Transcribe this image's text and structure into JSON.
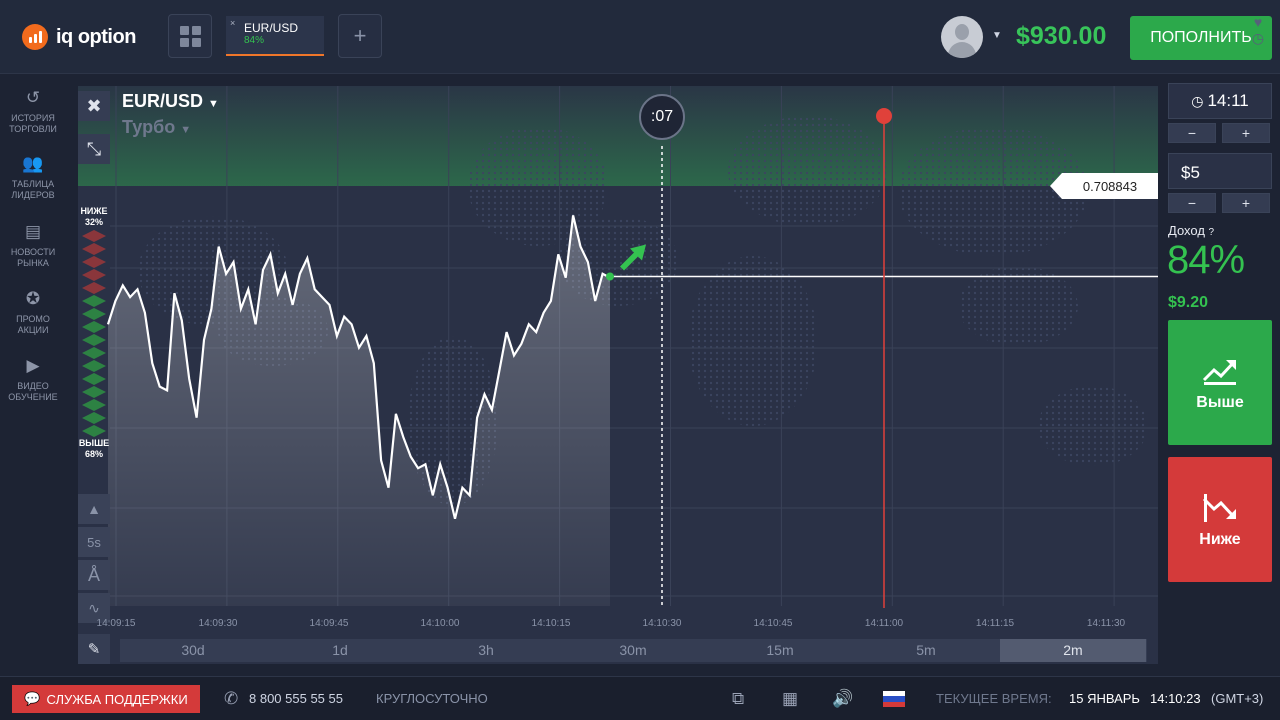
{
  "header": {
    "logo_text": "iq option",
    "asset_tab": {
      "close": "×",
      "name": "EUR/USD",
      "payout": "84%"
    },
    "add_tab": "+",
    "balance": "$930.00",
    "deposit_label": "ПОПОЛНИТЬ"
  },
  "sidebar": {
    "items": [
      {
        "label": "ИСТОРИЯ ТОРГОВЛИ",
        "icon": "history-icon"
      },
      {
        "label": "ТАБЛИЦА ЛИДЕРОВ",
        "icon": "leaders-icon"
      },
      {
        "label": "НОВОСТИ РЫНКА",
        "icon": "news-icon"
      },
      {
        "label": "ПРОМО АКЦИИ",
        "icon": "promo-icon"
      },
      {
        "label": "ВИДЕО ОБУЧЕНИЕ",
        "icon": "video-icon"
      }
    ]
  },
  "chart": {
    "pair": "EUR/USD",
    "mode": "Турбо",
    "timer": ":07",
    "current_price": "0.708843",
    "sentiment": {
      "lower_label": "НИЖЕ",
      "lower_pct": "32%",
      "higher_label": "ВЫШЕ",
      "higher_pct": "68%"
    },
    "tool_5s": "5s",
    "x_ticks": [
      "14:09:15",
      "14:09:30",
      "14:09:45",
      "14:10:00",
      "14:10:15",
      "14:10:30",
      "14:10:45",
      "14:11:00",
      "14:11:15",
      "14:11:30"
    ],
    "periods": [
      "30d",
      "1d",
      "3h",
      "30m",
      "15m",
      "5m",
      "2m"
    ],
    "active_period": "2m",
    "colors": {
      "line": "#ffffff",
      "up": "#34c250",
      "expiry_line": "#e0413a"
    }
  },
  "chart_data": {
    "type": "line",
    "title": "EUR/USD",
    "x_range": [
      "14:09:15",
      "14:10:27"
    ],
    "x_index": [
      0,
      1,
      2,
      3,
      4,
      5,
      6,
      7,
      8,
      9,
      10,
      11,
      12,
      13,
      14,
      15,
      16,
      17,
      18,
      19,
      20,
      21,
      22,
      23,
      24,
      25,
      26,
      27,
      28,
      29,
      30,
      31,
      32,
      33,
      34,
      35,
      36,
      37,
      38,
      39,
      40,
      41,
      42,
      43,
      44,
      45,
      46,
      47,
      48,
      49,
      50,
      51,
      52,
      53,
      54,
      55,
      56,
      57,
      58,
      59,
      60,
      61,
      62,
      63,
      64,
      65,
      66,
      67,
      68,
      69,
      70,
      71,
      72,
      73,
      74,
      75,
      76,
      77,
      78,
      79,
      80,
      81,
      82
    ],
    "series": [
      {
        "values": [
          0.70872,
          0.70878,
          0.70882,
          0.70879,
          0.70881,
          0.70875,
          0.70862,
          0.70856,
          0.70855,
          0.7088,
          0.70873,
          0.70858,
          0.70848,
          0.70868,
          0.70876,
          0.70892,
          0.70885,
          0.70888,
          0.70876,
          0.70881,
          0.70872,
          0.70886,
          0.7089,
          0.7088,
          0.70885,
          0.70877,
          0.70885,
          0.70889,
          0.70881,
          0.70879,
          0.70877,
          0.70869,
          0.70874,
          0.70872,
          0.70866,
          0.70869,
          0.70862,
          0.70837,
          0.7083,
          0.70849,
          0.70843,
          0.70838,
          0.70835,
          0.70836,
          0.70828,
          0.70836,
          0.7083,
          0.70822,
          0.7083,
          0.70828,
          0.70848,
          0.70854,
          0.7085,
          0.7086,
          0.7087,
          0.70864,
          0.70867,
          0.70872,
          0.7087,
          0.70875,
          0.70878,
          0.7089,
          0.70884,
          0.709,
          0.70892,
          0.70888,
          0.70878,
          0.70885,
          0.70884
        ]
      }
    ],
    "current_price": 0.708843,
    "y_range": [
      0.70815,
      0.70905
    ]
  },
  "right_panel": {
    "time": "14:11",
    "amount": "$5",
    "minus": "−",
    "plus": "+",
    "profit_label": "Доход",
    "profit_pct": "84%",
    "profit_amount": "$9.20",
    "call_label": "Выше",
    "put_label": "Ниже",
    "colors": {
      "call": "#2ca94b",
      "put": "#d43a3a"
    }
  },
  "footer": {
    "support": "СЛУЖБА ПОДДЕРЖКИ",
    "phone": "8 800 555 55 55",
    "hours": "КРУГЛОСУТОЧНО",
    "time_label": "ТЕКУЩЕЕ ВРЕМЯ:",
    "date": "15 ЯНВАРЬ",
    "time": "14:10:23",
    "tz": "(GMT+3)"
  }
}
